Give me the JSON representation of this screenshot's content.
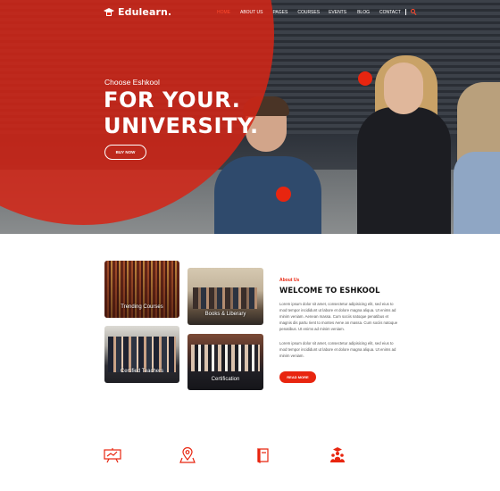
{
  "nav": {
    "logo_text": "Edulearn.",
    "items": [
      {
        "label": "HOME",
        "active": true
      },
      {
        "label": "ABOUT US",
        "active": false
      },
      {
        "label": "PAGES",
        "active": false
      },
      {
        "label": "COURSES",
        "active": false
      },
      {
        "label": "EVENTS",
        "active": false
      },
      {
        "label": "BLOG",
        "active": false
      },
      {
        "label": "CONTACT",
        "active": false
      }
    ],
    "search_icon": "search-icon"
  },
  "hero": {
    "subtitle": "Choose Eshkool",
    "title_line1": "FOR YOUR.",
    "title_line2": "UNIVERSITY.",
    "button_label": "BUY NOW"
  },
  "gallery": [
    {
      "label": "Trending Courses"
    },
    {
      "label": "Books & Liberary"
    },
    {
      "label": "Certified Teachers"
    },
    {
      "label": "Certification"
    }
  ],
  "about": {
    "kicker": "About Us",
    "title": "WELCOME TO ESHKOOL",
    "paragraph1": "Lorem ipsum dolor sit amet, consectetur adipisicing elit, sed eius to mod tempor incididunt ut labore et dolore magna aliqua. Ut enims ad minim veniam. Aenean massa. Cum sociis natoque penatibus et magnis dis partu rient to montes Aene an massa. Cum sociis natoque penatibus. Ut enims ad minim veniam.",
    "paragraph2": "Lorem ipsum dolor sit amet, consectetur adipisicing elit, sed eius to mod tempor incididunt ut labore et dolore magna aliqua. Ut enims ad minim veniam.",
    "button_label": "READ MORE"
  },
  "features": {
    "icons": [
      "presentation-board-icon",
      "location-pin-icon",
      "book-icon",
      "graduate-students-icon"
    ]
  },
  "colors": {
    "accent": "#e8250f",
    "hero_overlay": "#d42516",
    "text_dark": "#111111",
    "text_body": "#555555"
  }
}
